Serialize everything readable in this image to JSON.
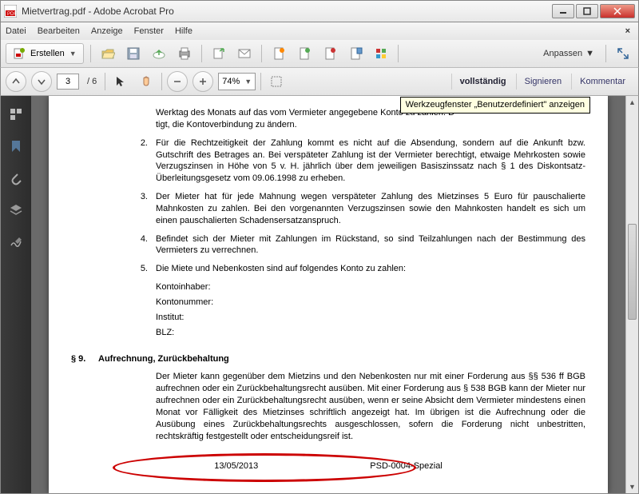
{
  "window": {
    "title": "Mietvertrag.pdf - Adobe Acrobat Pro"
  },
  "menu": {
    "datei": "Datei",
    "bearbeiten": "Bearbeiten",
    "anzeige": "Anzeige",
    "fenster": "Fenster",
    "hilfe": "Hilfe"
  },
  "toolbar": {
    "erstellen": "Erstellen",
    "anpassen": "Anpassen"
  },
  "nav": {
    "page_current": "3",
    "page_total": "/  6",
    "zoom": "74%",
    "vollstaendig": "vollständig",
    "signieren": "Signieren",
    "kommentar": "Kommentar"
  },
  "tooltip": "Werkzeugfenster „Benutzerdefiniert\" anzeigen",
  "doc": {
    "item1_partial": "Werktag des Monats auf das vom Vermieter angegebene Konto zu zahlen. D",
    "item1_line2": "tigt, die Kontoverbindung zu ändern.",
    "item2": "Für die Rechtzeitigkeit der Zahlung kommt es nicht auf die Absendung, sondern auf die Ankunft bzw. Gutschrift des Betrages an. Bei verspäteter Zahlung ist der Vermieter berechtigt, etwaige Mehrkosten sowie Verzugszinsen in Höhe von 5 v. H. jährlich über dem jeweiligen Basiszinssatz nach § 1 des Diskontsatz-Überleitungsgesetz vom 09.06.1998 zu erheben.",
    "item3": "Der Mieter hat für jede Mahnung wegen verspäteter Zahlung des Mietzinses 5 Euro für pauschalierte Mahnkosten zu zahlen. Bei den vorgenannten Verzugszinsen sowie den Mahnkosten handelt es sich um einen pauschalierten Schadensersatzanspruch.",
    "item4": "Befindet sich der Mieter mit Zahlungen im Rückstand, so sind Teilzahlungen nach der Bestimmung des Vermieters zu verrechnen.",
    "item5": "Die Miete und Nebenkosten sind auf folgendes Konto zu zahlen:",
    "konto": {
      "inhaber": "Kontoinhaber:",
      "nummer": "Kontonummer:",
      "institut": "Institut:",
      "blz": "BLZ:"
    },
    "sec_num": "§ 9.",
    "sec_title": "Aufrechnung, Zurückbehaltung",
    "sec_body": "Der Mieter kann gegenüber dem Mietzins und den Nebenkosten nur mit einer Forderung aus §§ 536 ff BGB aufrechnen oder ein Zurückbehaltungsrecht ausüben. Mit einer Forderung aus § 538 BGB kann der Mieter nur aufrechnen oder ein Zurückbehaltungsrecht ausüben, wenn er seine Absicht dem Vermieter mindestens einen Monat vor Fälligkeit des Mietzinses schriftlich angezeigt hat. Im übrigen ist die Aufrechnung oder die Ausübung eines Zurückbehaltungsrechts ausgeschlossen, sofern die Forderung nicht unbestritten, rechtskräftig festgestellt oder entscheidungsreif ist.",
    "footer_date": "13/05/2013",
    "footer_id": "PSD-0004-Spezial"
  }
}
